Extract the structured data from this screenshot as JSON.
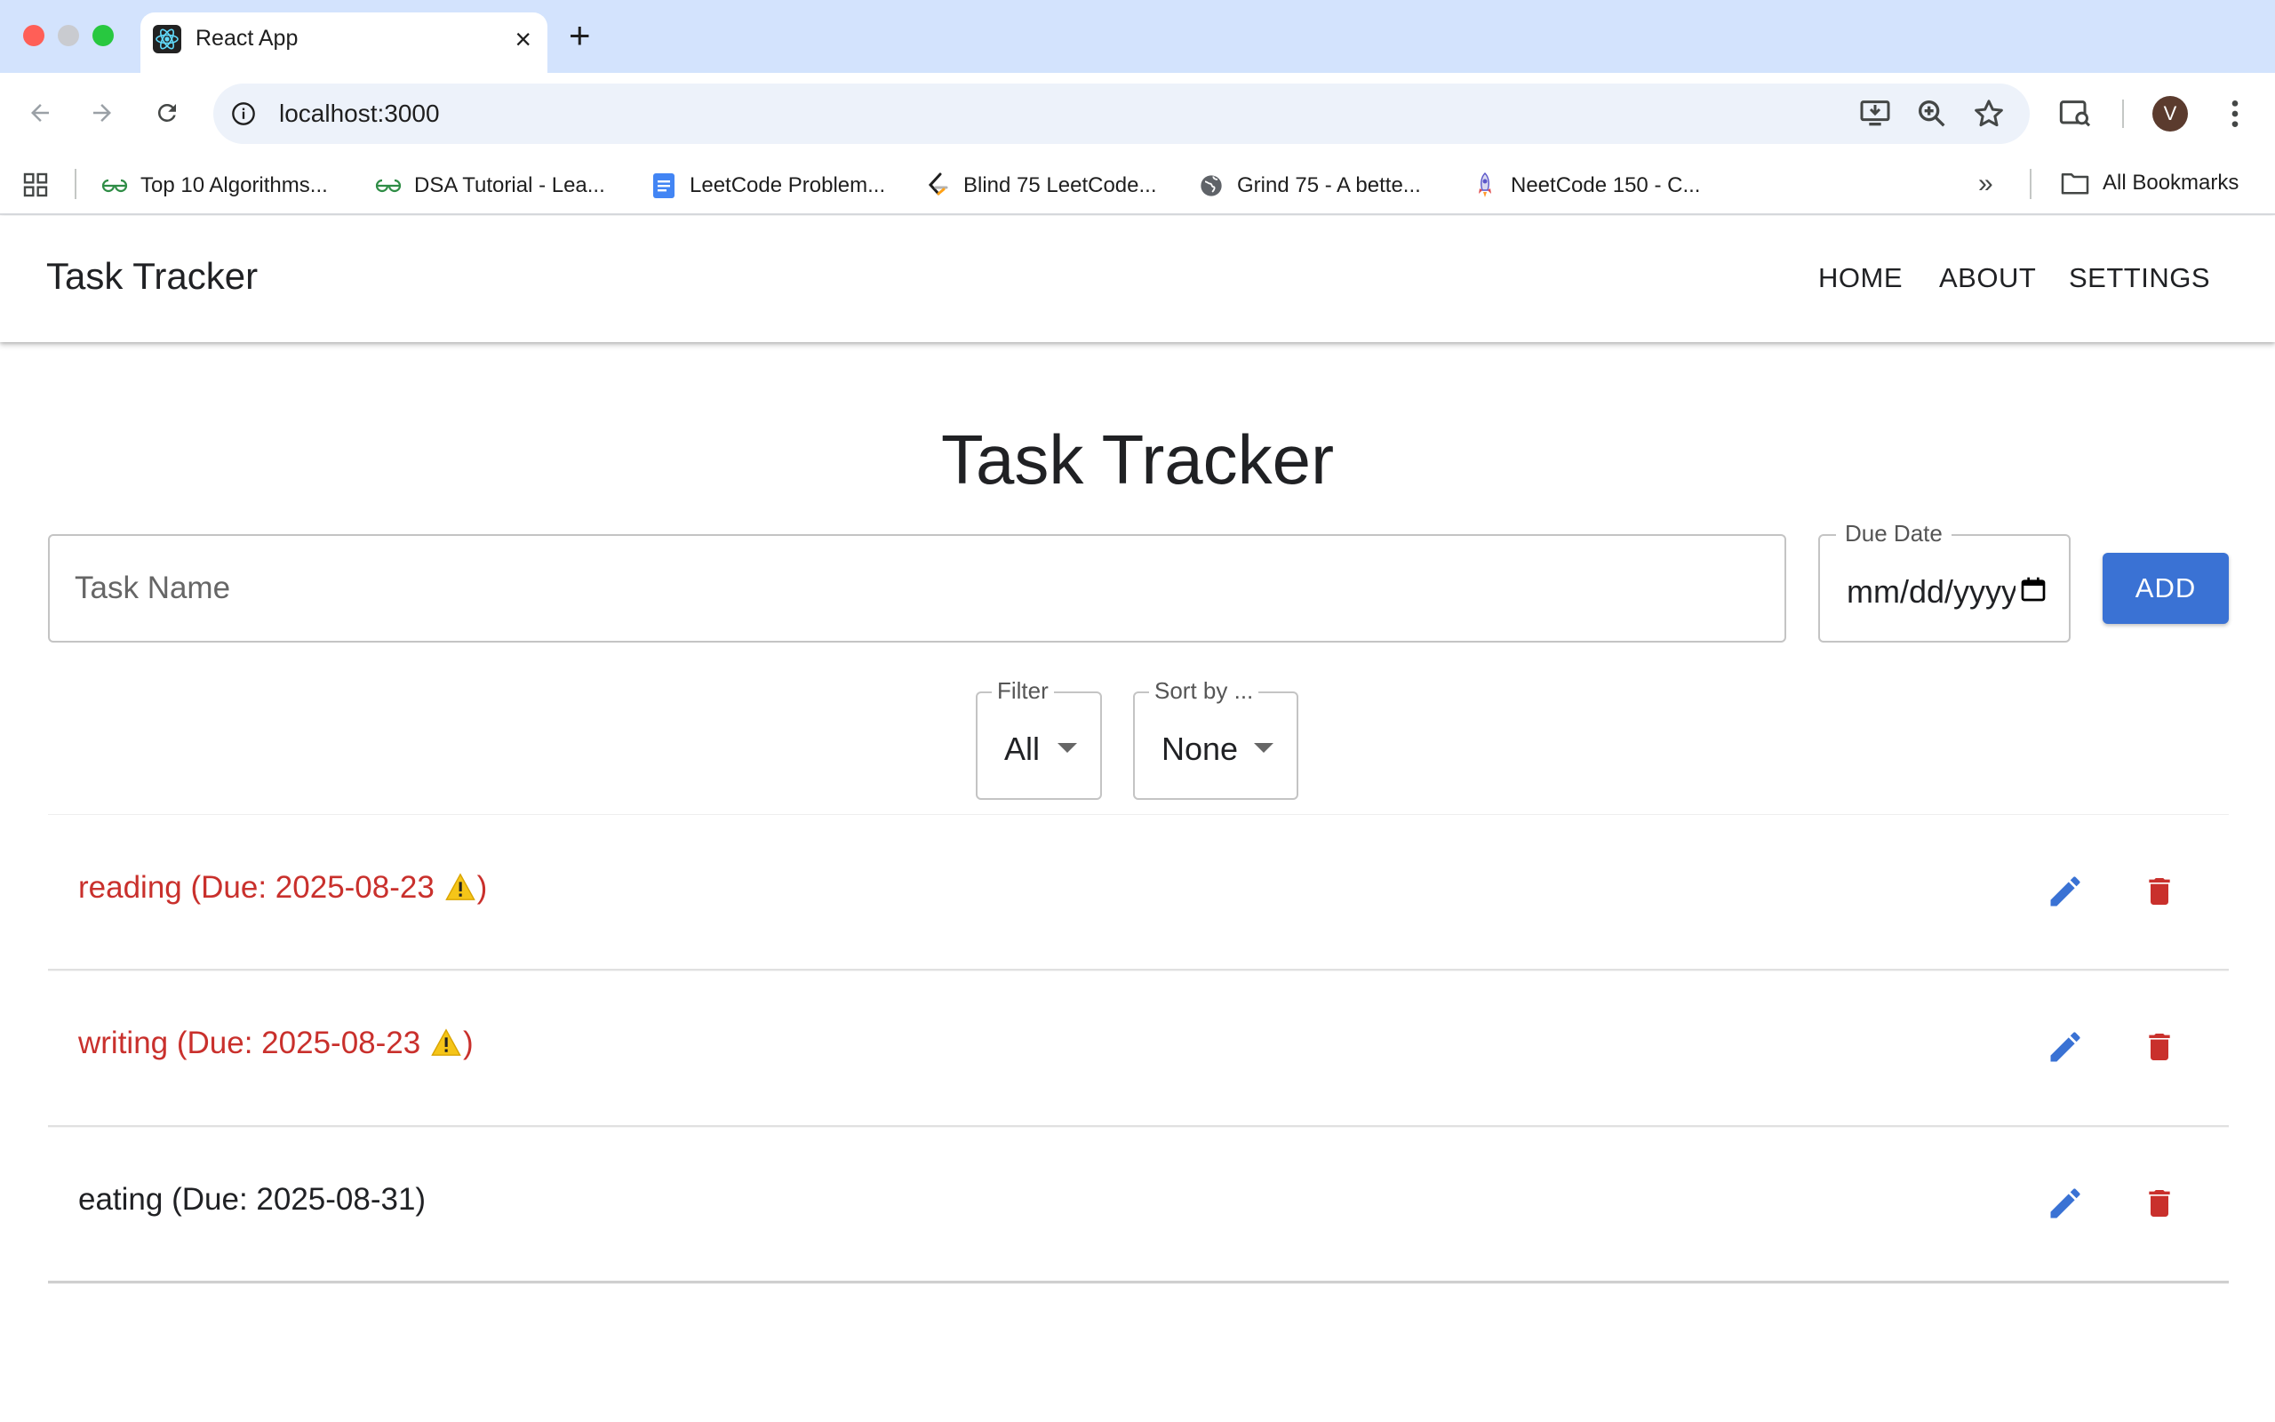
{
  "browser": {
    "tab_title": "React App",
    "tab_close": "×",
    "new_tab": "+",
    "url": "localhost:3000",
    "avatar_letter": "V",
    "bookmarks": [
      {
        "label": "Top 10 Algorithms...",
        "icon": "geeksforgeeks-icon"
      },
      {
        "label": "DSA Tutorial - Lea...",
        "icon": "geeksforgeeks-icon"
      },
      {
        "label": "LeetCode Problem...",
        "icon": "google-docs-icon"
      },
      {
        "label": "Blind 75 LeetCode...",
        "icon": "leetcode-icon"
      },
      {
        "label": "Grind 75 - A bette...",
        "icon": "globe-icon"
      },
      {
        "label": "NeetCode 150 - C...",
        "icon": "rocket-icon"
      }
    ],
    "more_bookmarks": "»",
    "all_bookmarks": "All Bookmarks"
  },
  "appbar": {
    "brand": "Task Tracker",
    "nav": [
      "HOME",
      "ABOUT",
      "SETTINGS"
    ]
  },
  "main": {
    "title": "Task Tracker",
    "task_input_placeholder": "Task Name",
    "due_date_label": "Due Date",
    "due_date_value": "mm/dd/yyyy",
    "add_label": "ADD",
    "filter": {
      "label": "Filter",
      "value": "All"
    },
    "sort": {
      "label": "Sort by ...",
      "value": "None"
    },
    "tasks": [
      {
        "prefix": "reading (Due: 2025-08-23 ",
        "warning": "⚠",
        "suffix": ")",
        "overdue": true
      },
      {
        "prefix": "writing (Due: 2025-08-23 ",
        "warning": "⚠",
        "suffix": ")",
        "overdue": true
      },
      {
        "prefix": "eating (Due: 2025-08-31)",
        "warning": "",
        "suffix": "",
        "overdue": false
      }
    ]
  },
  "colors": {
    "accent": "#3a72d4",
    "overdue": "#c9302c",
    "delete": "#c9302c",
    "edit": "#3a72d4",
    "tabstrip": "#d3e3fd"
  }
}
